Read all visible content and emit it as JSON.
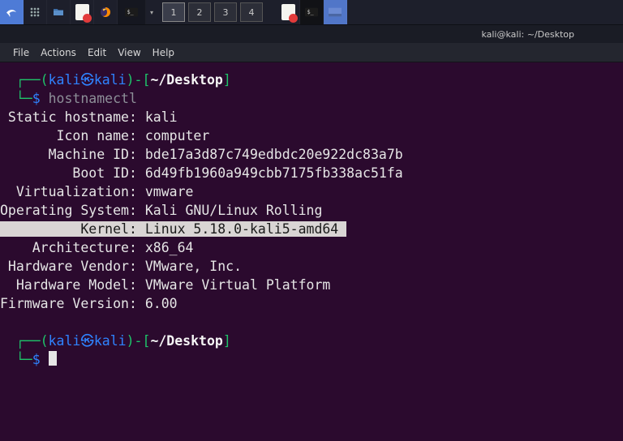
{
  "taskbar": {
    "launchers": [
      {
        "name": "kali-menu-icon"
      },
      {
        "name": "activities-icon"
      },
      {
        "name": "files-icon"
      },
      {
        "name": "doc-badge-icon"
      },
      {
        "name": "firefox-icon"
      },
      {
        "name": "terminal-launcher-icon"
      }
    ],
    "workspaces": [
      "1",
      "2",
      "3",
      "4"
    ],
    "active_workspace": 0,
    "windows": [
      {
        "name": "doc-badge-window"
      },
      {
        "name": "terminal-window"
      },
      {
        "name": "highlighted-app-window"
      }
    ]
  },
  "window_title": "kali@kali: ~/Desktop",
  "menu": {
    "file": "File",
    "actions": "Actions",
    "edit": "Edit",
    "view": "View",
    "help": "Help"
  },
  "prompt": {
    "user": "kali",
    "host": "kali",
    "path": "~/Desktop",
    "symbol": "$"
  },
  "command": "hostnamectl",
  "output": {
    "static_hostname": {
      "label": " Static hostname",
      "value": "kali"
    },
    "icon_name": {
      "label": "       Icon name",
      "value": "computer"
    },
    "machine_id": {
      "label": "      Machine ID",
      "value": "bde17a3d87c749edbdc20e922dc83a7b"
    },
    "boot_id": {
      "label": "         Boot ID",
      "value": "6d49fb1960a949cbb7175fb338ac51fa"
    },
    "virtualization": {
      "label": "  Virtualization",
      "value": "vmware"
    },
    "operating_system": {
      "label": "Operating System",
      "value": "Kali GNU/Linux Rolling"
    },
    "kernel": {
      "label": "          Kernel",
      "value": "Linux 5.18.0-kali5-amd64"
    },
    "architecture": {
      "label": "    Architecture",
      "value": "x86_64"
    },
    "hardware_vendor": {
      "label": " Hardware Vendor",
      "value": "VMware, Inc."
    },
    "hardware_model": {
      "label": "  Hardware Model",
      "value": "VMware Virtual Platform"
    },
    "firmware_version": {
      "label": "Firmware Version",
      "value": "6.00"
    }
  }
}
